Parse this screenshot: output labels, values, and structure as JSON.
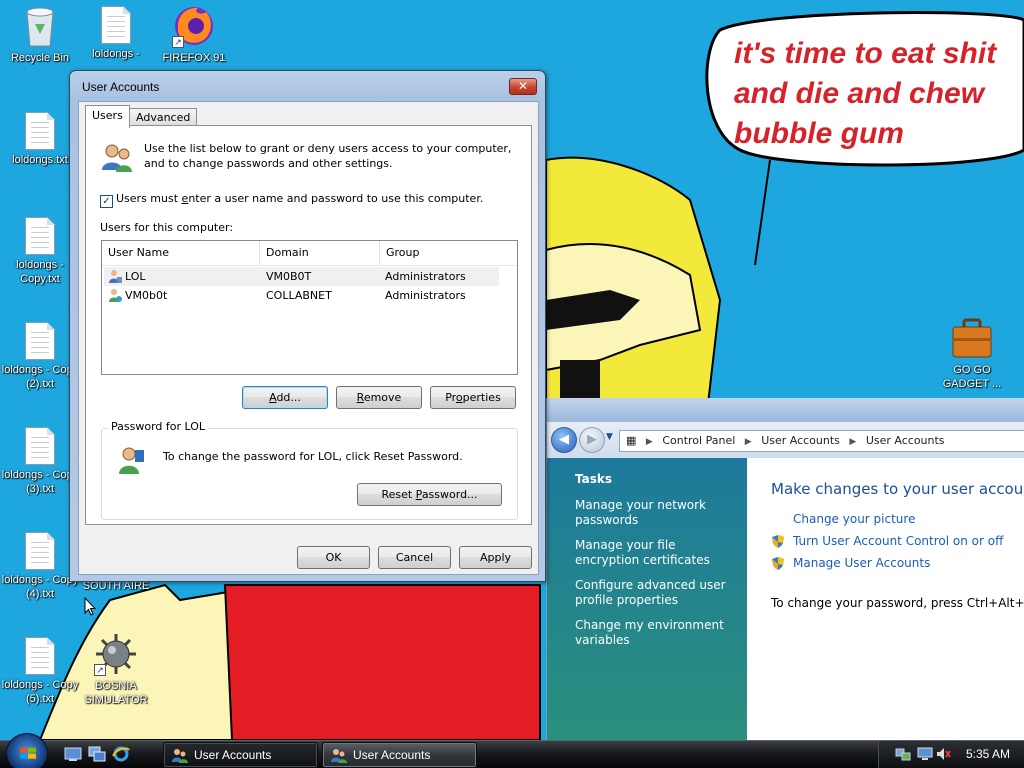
{
  "desktop": {
    "speech_bubble": "it's time to eat shit\nand die and chew\nbubble gum",
    "icons": [
      {
        "label": "Recycle Bin",
        "icon": "recycle-bin-icon"
      },
      {
        "label": "loldongs -",
        "icon": "text-document-icon"
      },
      {
        "label": "FIREFOX 91",
        "icon": "firefox-icon"
      },
      {
        "label": "loldongs.txt",
        "icon": "text-document-icon"
      },
      {
        "label": "loldongs - Copy.txt",
        "icon": "text-document-icon"
      },
      {
        "label": "loldongs - Copy (2).txt",
        "icon": "text-document-icon"
      },
      {
        "label": "loldongs - Copy (3).txt",
        "icon": "text-document-icon"
      },
      {
        "label": "loldongs - Copy (4).txt",
        "icon": "text-document-icon"
      },
      {
        "label": "loldongs - Copy (5).txt",
        "icon": "text-document-icon"
      },
      {
        "label": "SOUTH AIRE",
        "icon": "shortcut-icon"
      },
      {
        "label": "BOSNIA SIMULATOR",
        "icon": "spiked-mine-icon"
      },
      {
        "label": "GO GO GADGET ...",
        "icon": "briefcase-icon"
      }
    ]
  },
  "dialog": {
    "title": "User Accounts",
    "close_label": "✕",
    "tabs": [
      "Users",
      "Advanced"
    ],
    "intro": "Use the list below to grant or deny users access to your computer, and to change passwords and other settings.",
    "require_password": {
      "checked": true,
      "mark": "✓",
      "pre": "Users must ",
      "accel": "e",
      "post": "nter a user name and password to use this computer."
    },
    "users_label": "Users for this computer:",
    "columns": [
      "User Name",
      "Domain",
      "Group"
    ],
    "users": [
      {
        "name": "LOL",
        "domain": "VM0B0T",
        "group": "Administrators",
        "selected": true
      },
      {
        "name": "VM0b0t",
        "domain": "COLLABNET",
        "group": "Administrators",
        "selected": false
      }
    ],
    "buttons": {
      "add": {
        "accel": "A",
        "post": "dd..."
      },
      "remove": {
        "accel": "R",
        "post": "emove"
      },
      "properties": {
        "pre": "Pr",
        "accel": "o",
        "post": "perties"
      },
      "reset": {
        "pre": "Reset ",
        "accel": "P",
        "post": "assword..."
      },
      "ok": "OK",
      "cancel": "Cancel",
      "apply": "Apply"
    },
    "password_group": "Password for LOL",
    "password_text": "To change the password for LOL, click Reset Password."
  },
  "control_panel": {
    "breadcrumb": [
      "Control Panel",
      "User Accounts",
      "User Accounts"
    ],
    "tasks_title": "Tasks",
    "tasks": [
      "Manage your network passwords",
      "Manage your file encryption certificates",
      "Configure advanced user profile properties",
      "Change my environment variables"
    ],
    "heading": "Make changes to your user account",
    "links": [
      "Change your picture",
      "Turn User Account Control on or off",
      "Manage User Accounts"
    ],
    "note": "To change your password, press Ctrl+Alt+Del and"
  },
  "taskbar": {
    "buttons": [
      "User Accounts",
      "User Accounts"
    ],
    "clock": "5:35 AM"
  },
  "colors": {
    "accent": "#1ea7df",
    "link": "#1b5eb8",
    "close": "#c9452c"
  }
}
